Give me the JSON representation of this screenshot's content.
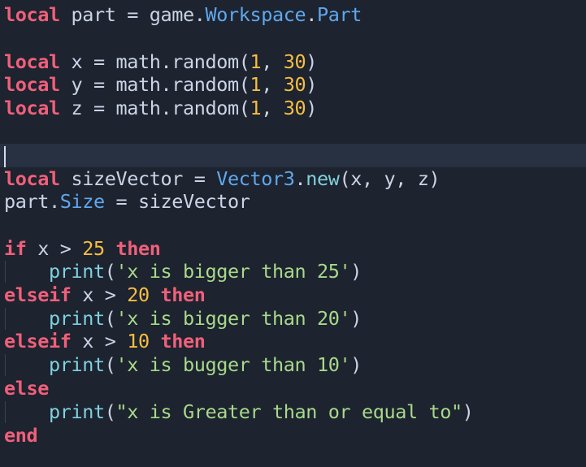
{
  "code": {
    "line1": {
      "kw": "local",
      "var": " part = game.",
      "p1": "Workspace",
      "dot": ".",
      "p2": "Part"
    },
    "line3": {
      "kw": "local",
      "pre": " x = math.random(",
      "n1": "1",
      "mid": ", ",
      "n2": "30",
      "post": ")"
    },
    "line4": {
      "kw": "local",
      "pre": " y = math.random(",
      "n1": "1",
      "mid": ", ",
      "n2": "30",
      "post": ")"
    },
    "line5": {
      "kw": "local",
      "pre": " z = math.random(",
      "n1": "1",
      "mid": ", ",
      "n2": "30",
      "post": ")"
    },
    "line8": {
      "kw": "local",
      "pre": " sizeVector = ",
      "cls": "Vector3",
      "dot": ".",
      "fn": "new",
      "post": "(x, y, z)"
    },
    "line9": {
      "pre": "part.",
      "prop": "Size",
      "post": " = sizeVector"
    },
    "line11": {
      "kw1": "if",
      "pre": " x > ",
      "num": "25",
      "sp": " ",
      "kw2": "then"
    },
    "line12": {
      "indent": "    ",
      "fn": "print",
      "open": "(",
      "str": "'x is bigger than 25'",
      "close": ")"
    },
    "line13": {
      "kw1": "elseif",
      "pre": " x > ",
      "num": "20",
      "sp": " ",
      "kw2": "then"
    },
    "line14": {
      "indent": "    ",
      "fn": "print",
      "open": "(",
      "str": "'x is bigger than 20'",
      "close": ")"
    },
    "line15": {
      "kw1": "elseif",
      "pre": " x > ",
      "num": "10",
      "sp": " ",
      "kw2": "then"
    },
    "line16": {
      "indent": "    ",
      "fn": "print",
      "open": "(",
      "str": "'x is bugger than 10'",
      "close": ")"
    },
    "line17": {
      "kw": "else"
    },
    "line18": {
      "indent": "    ",
      "fn": "print",
      "open": "(",
      "str": "\"x is Greater than or equal to\"",
      "close": ")"
    },
    "line19": {
      "kw": "end"
    }
  },
  "colors": {
    "background": "#1d232f",
    "current_line": "#283142",
    "keyword": "#f0607a",
    "number": "#f7be42",
    "string": "#a8d98a",
    "function": "#7fd1e0",
    "property": "#5fa8ee",
    "text": "#cbd4e6"
  }
}
